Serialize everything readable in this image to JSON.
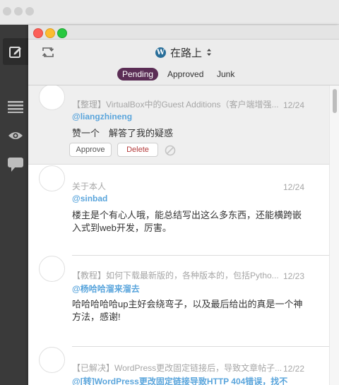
{
  "site": {
    "name": "在路上"
  },
  "tabs": [
    {
      "label": "Pending",
      "active": true
    },
    {
      "label": "Approved",
      "active": false
    },
    {
      "label": "Junk",
      "active": false
    }
  ],
  "comments": [
    {
      "post_title": "【整理】VirtualBox中的Guest Additions（客户端增强...",
      "author": "@liangzhineng",
      "date": "12/24",
      "body": "赞一个　解答了我的疑惑",
      "actions": {
        "approve": "Approve",
        "delete": "Delete"
      }
    },
    {
      "post_title": "关于本人",
      "author": "@sinbad",
      "date": "12/24",
      "body": "楼主是个有心人哦，能总结写出这么多东西，还能横跨嵌入式到web开发，厉害。"
    },
    {
      "post_title": "【教程】如何下载最新版的，各种版本的，包括Pytho...",
      "author": "@杨哈哈溜来溜去",
      "date": "12/23",
      "body": "哈哈哈哈哈up主好会绕弯子，以及最后给出的真是一个神方法，感谢!"
    },
    {
      "post_title": "【已解决】WordPress更改固定链接后，导致文章帖子...",
      "author": "@[转]WordPress更改固定链接导致HTTP 404错误，找不",
      "date": "12/22",
      "body": ""
    }
  ],
  "colors": {
    "accent": "#5b2d55",
    "author": "#5aa5dc",
    "delete": "#b43c3c"
  },
  "icons": {
    "compose": "compose-icon",
    "menu": "menu-icon",
    "eye": "eye-icon",
    "chat": "speech-bubble-icon",
    "refresh": "refresh-icon",
    "spam": "spam-icon"
  }
}
